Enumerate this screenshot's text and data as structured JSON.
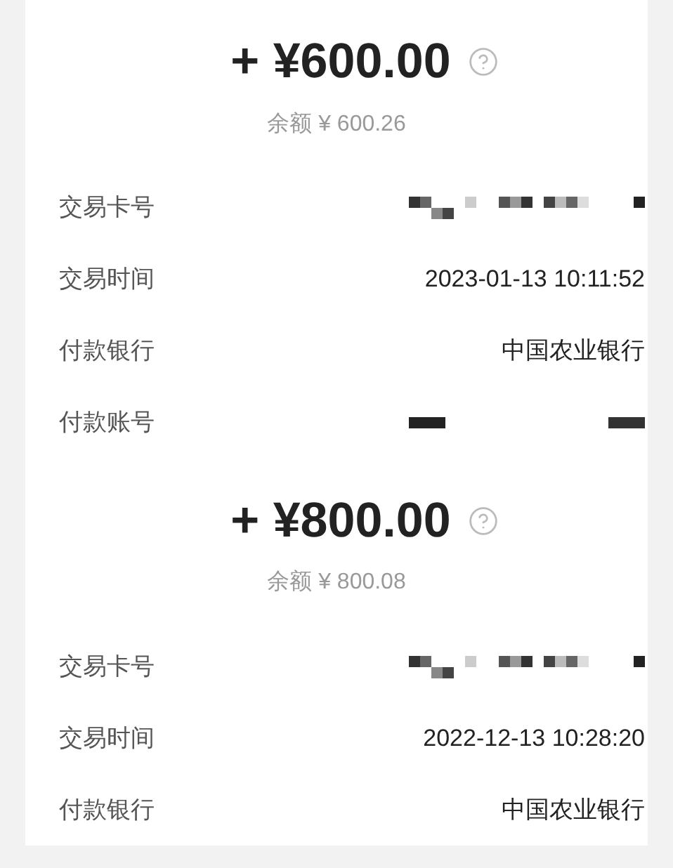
{
  "panels": [
    {
      "amount": "+ ¥600.00",
      "balance": "余额 ¥ 600.26",
      "rows": [
        {
          "kind": "masked",
          "label": "交易卡号"
        },
        {
          "kind": "text",
          "label": "交易时间",
          "value": "2023-01-13 10:11:52"
        },
        {
          "kind": "text",
          "label": "付款银行",
          "value": "中国农业银行"
        },
        {
          "kind": "bars",
          "label": "付款账号"
        }
      ]
    },
    {
      "amount": "+ ¥800.00",
      "balance": "余额 ¥ 800.08",
      "rows": [
        {
          "kind": "masked",
          "label": "交易卡号"
        },
        {
          "kind": "text",
          "label": "交易时间",
          "value": "2022-12-13 10:28:20"
        },
        {
          "kind": "text",
          "label": "付款银行",
          "value": "中国农业银行"
        }
      ]
    }
  ]
}
